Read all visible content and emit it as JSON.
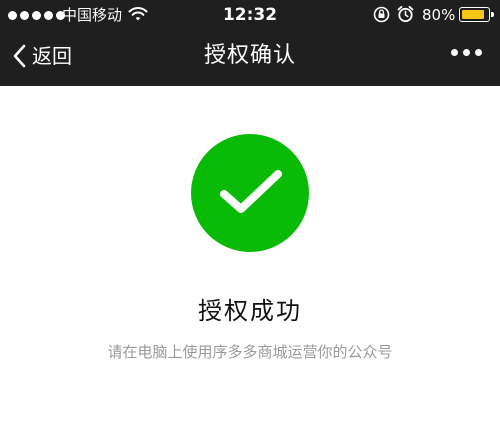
{
  "status_bar": {
    "carrier": "中国移动",
    "time": "12:32",
    "battery_percent": "80%",
    "battery_level": 0.8,
    "signal_bars": 5,
    "icons": [
      "wifi-icon",
      "rotation-lock-icon",
      "alarm-icon",
      "battery-icon"
    ]
  },
  "nav": {
    "back_label": "返回",
    "title": "授权确认",
    "more_icon": "more-dots-icon"
  },
  "result": {
    "icon": "success-check-icon",
    "title": "授权成功",
    "description": "请在电脑上使用序多多商城运营你的公众号"
  },
  "colors": {
    "header_bg": "#1f1f20",
    "success_green": "#09bb07",
    "battery_yellow": "#f5c518",
    "desc_gray": "#9a9a9a"
  }
}
